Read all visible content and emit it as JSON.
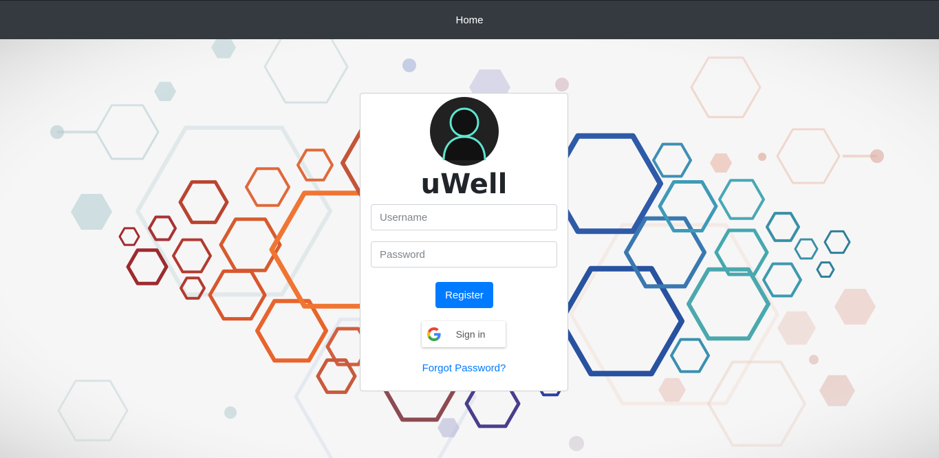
{
  "navbar": {
    "home_label": "Home"
  },
  "login": {
    "app_name": "uWell",
    "username_placeholder": "Username",
    "password_placeholder": "Password",
    "register_label": "Register",
    "google_signin_label": "Sign in",
    "forgot_password_label": "Forgot Password?"
  },
  "icons": {
    "avatar": "user-avatar-icon",
    "google": "google-logo-icon"
  },
  "colors": {
    "navbar_bg": "#343a40",
    "primary": "#007bff",
    "avatar_bg": "#212121",
    "avatar_outline": "#5ee6d0"
  }
}
